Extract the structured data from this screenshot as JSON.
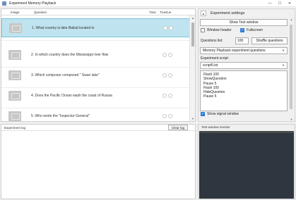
{
  "window": {
    "title": "Experiment Memory Playback",
    "minimize": "—",
    "maximize": "☐",
    "close": "✕"
  },
  "questions": {
    "columns": {
      "image": "Image",
      "question": "Question",
      "time": "Time",
      "true_lie": "True/Lie"
    },
    "rows": [
      {
        "text": "1. What country is lake Baikal located in",
        "selected": true
      },
      {
        "text": "2. In which country does the Mississippi river flow",
        "selected": false
      },
      {
        "text": "3. Which composer composed \" Swan lake\"",
        "selected": false
      },
      {
        "text": "4. Does the Pacific Ocean wash the coast of Russia",
        "selected": false
      },
      {
        "text": "5. Who wrote the \"Inspector-General\"",
        "selected": false
      }
    ]
  },
  "settings": {
    "title": "Experiment settings",
    "collapse_icon": "▲",
    "show_test_window": "Show Test window",
    "window_header": "Window header",
    "window_header_checked": false,
    "fullscreen": "Fullscreen",
    "fullscreen_checked": true,
    "questions_list_label": "Questions list:",
    "questions_list_value": "100",
    "shuffle_questions": "Shuffle questions",
    "mode_value": "Memory Playback experiment questions",
    "script_label": "Experiment script:",
    "script_file": "script5.txt",
    "script_lines": [
      "Flash 100",
      "ShowQuestion",
      "Pause 5",
      "Flash 100",
      "HideQuestion",
      "Pause 5"
    ],
    "show_signal_window": "Show signal window",
    "show_signal_window_checked": true
  },
  "log": {
    "title": "Experiment log",
    "clear_button": "Clear log"
  },
  "monitor": {
    "title": "Test window monitor"
  },
  "colors": {
    "selected_row": "#bfe3ef",
    "checkbox_on": "#2e7cd6",
    "monitor_bg": "#2f3640"
  }
}
